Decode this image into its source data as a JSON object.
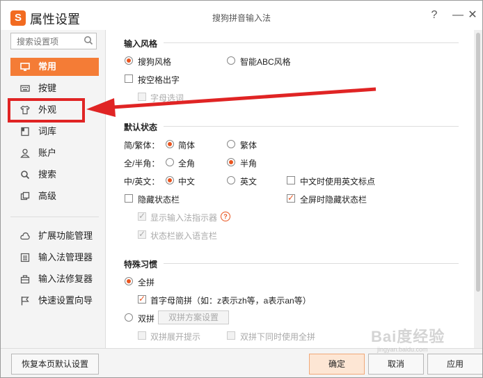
{
  "window": {
    "title": "属性设置",
    "app_name": "搜狗拼音输入法",
    "logo_char": "S"
  },
  "title_buttons": {
    "help": "?",
    "minimize": "—",
    "close": "✕"
  },
  "sidebar": {
    "search_placeholder": "搜索设置项",
    "items": [
      {
        "label": "常用",
        "icon": "monitor-icon",
        "active": true
      },
      {
        "label": "按键",
        "icon": "keyboard-icon"
      },
      {
        "label": "外观",
        "icon": "tshirt-icon"
      },
      {
        "label": "词库",
        "icon": "book-icon"
      },
      {
        "label": "账户",
        "icon": "user-icon"
      },
      {
        "label": "搜索",
        "icon": "search-icon"
      },
      {
        "label": "高级",
        "icon": "layers-icon"
      }
    ],
    "tools": [
      {
        "label": "扩展功能管理",
        "icon": "cloud-icon"
      },
      {
        "label": "输入法管理器",
        "icon": "list-icon"
      },
      {
        "label": "输入法修复器",
        "icon": "toolbox-icon"
      },
      {
        "label": "快速设置向导",
        "icon": "flag-icon"
      }
    ]
  },
  "input_style": {
    "title": "输入风格",
    "option_sogou": "搜狗风格",
    "option_abc": "智能ABC风格",
    "space_output": "按空格出字",
    "letter_select": "字母选词"
  },
  "default_state": {
    "title": "默认状态",
    "simp_trad_label": "简/繁体：",
    "simplified": "简体",
    "traditional": "繁体",
    "width_label": "全/半角：",
    "full_width": "全角",
    "half_width": "半角",
    "cn_en_label": "中/英文：",
    "chinese": "中文",
    "english": "英文",
    "cn_en_punct": "中文时使用英文标点",
    "hide_status_bar": "隐藏状态栏",
    "fullscreen_hide": "全屏时隐藏状态栏",
    "show_indicator": "显示输入法指示器",
    "embed_language_bar": "状态栏嵌入语言栏",
    "help_glyph": "?"
  },
  "special_habits": {
    "title": "特殊习惯",
    "full_pinyin": "全拼",
    "initials_abbrev": "首字母简拼（如：z表示zh等，a表示an等）",
    "double_pinyin": "双拼",
    "double_scheme_button": "双拼方案设置",
    "double_expand_hint": "双拼展开提示",
    "double_with_full": "双拼下同时使用全拼"
  },
  "footer": {
    "restore": "恢复本页默认设置",
    "ok": "确定",
    "cancel": "取消",
    "apply": "应用"
  },
  "watermark": {
    "brand": "Bai度经验",
    "url": "jingyan.baidu.com"
  },
  "colors": {
    "accent": "#f47c36",
    "annotation_red": "#e02424"
  }
}
